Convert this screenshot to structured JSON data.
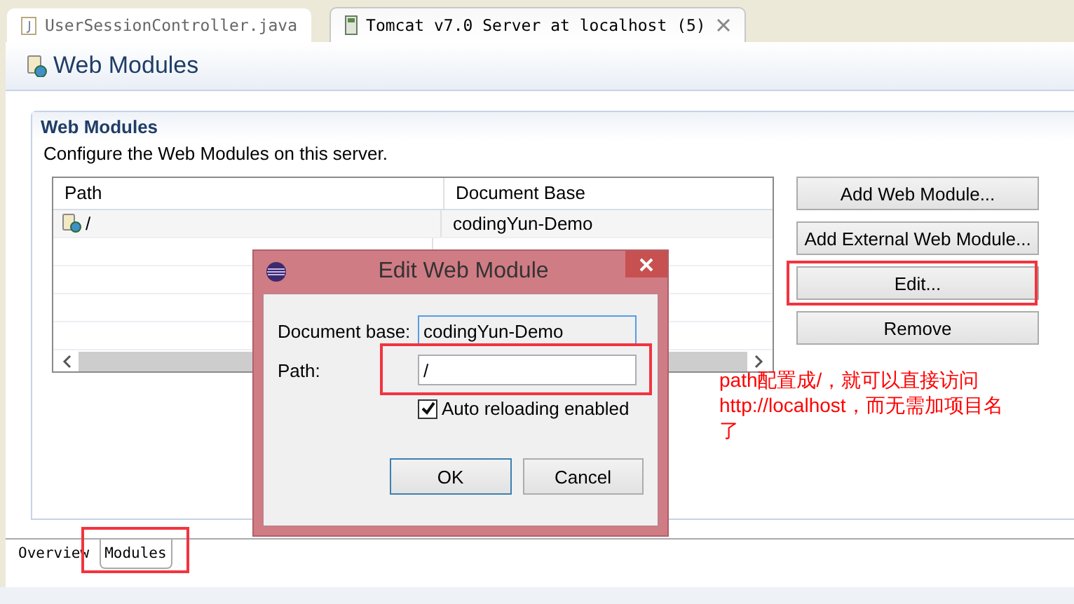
{
  "editor_tabs": [
    {
      "label": "UserSessionController.java",
      "selected": false,
      "kind": "java",
      "closable": false
    },
    {
      "label": "Tomcat v7.0 Server at localhost (5)",
      "selected": true,
      "kind": "server",
      "closable": true
    }
  ],
  "page_title": "Web Modules",
  "section": {
    "title": "Web Modules",
    "description": "Configure the Web Modules on this server."
  },
  "table": {
    "columns": [
      "Path",
      "Document Base"
    ],
    "rows": [
      {
        "path": "/",
        "document_base": "codingYun-Demo"
      }
    ]
  },
  "buttons": [
    {
      "label": "Add Web Module...",
      "highlighted": false
    },
    {
      "label": "Add External Web Module...",
      "highlighted": false
    },
    {
      "label": "Edit...",
      "highlighted": true
    },
    {
      "label": "Remove",
      "highlighted": false
    }
  ],
  "dialog": {
    "title": "Edit Web Module",
    "document_base_label": "Document base:",
    "document_base": "codingYun-Demo",
    "path_label": "Path:",
    "path": "/",
    "path_highlighted": true,
    "auto_reload": {
      "label": "Auto reloading enabled",
      "checked": true
    },
    "buttons": [
      {
        "label": "OK",
        "default": true
      },
      {
        "label": "Cancel",
        "default": false
      }
    ]
  },
  "annotation_lines": [
    "path配置成/，就可以直接访问",
    "http://localhost，而无需加项目名",
    "了"
  ],
  "bottom_tabs": [
    {
      "label": "Overview",
      "selected": false,
      "highlighted": false
    },
    {
      "label": "Modules",
      "selected": true,
      "highlighted": true
    }
  ]
}
